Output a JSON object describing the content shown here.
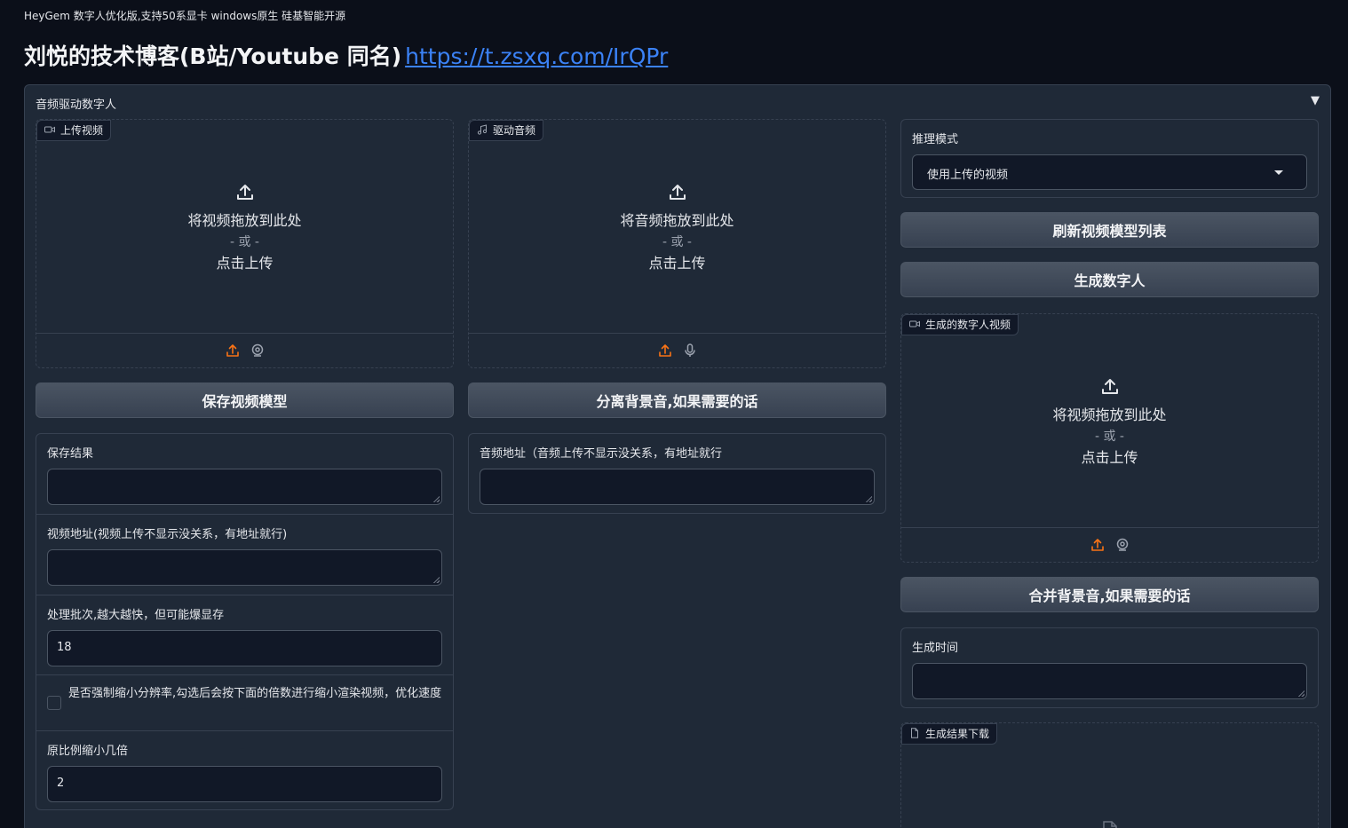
{
  "page": {
    "top_note": "HeyGem 数字人优化版,支持50系显卡 windows原生 硅基智能开源",
    "headline_text": "刘悦的技术博客(B站/Youtube 同名)",
    "headline_link": "https://t.zsxq.com/IrQPr"
  },
  "panel": {
    "title": "音频驱动数字人",
    "toggle": "▼"
  },
  "video_upload": {
    "tag": "上传视频",
    "drop_text": "将视频拖放到此处",
    "or_text": "- 或 -",
    "click_text": "点击上传"
  },
  "audio_upload": {
    "tag": "驱动音频",
    "drop_text": "将音频拖放到此处",
    "or_text": "- 或 -",
    "click_text": "点击上传"
  },
  "buttons": {
    "save_model": "保存视频模型",
    "separate_bg": "分离背景音,如果需要的话",
    "refresh_models": "刷新视频模型列表",
    "generate": "生成数字人",
    "merge_bg": "合并背景音,如果需要的话"
  },
  "left_form": {
    "save_result_label": "保存结果",
    "save_result_value": "",
    "video_path_label": "视频地址(视频上传不显示没关系，有地址就行)",
    "video_path_value": "",
    "batch_label": "处理批次,越大越快，但可能爆显存",
    "batch_value": "18",
    "force_downscale_label": "是否强制缩小分辨率,勾选后会按下面的倍数进行缩小渲染视频，优化速度",
    "force_downscale_checked": false,
    "scale_label": "原比例缩小几倍",
    "scale_value": "2"
  },
  "mid_form": {
    "audio_path_label": "音频地址（音频上传不显示没关系，有地址就行",
    "audio_path_value": ""
  },
  "right": {
    "mode_label": "推理模式",
    "mode_selected": "使用上传的视频",
    "output_video_tag": "生成的数字人视频",
    "output_drop_text": "将视频拖放到此处",
    "output_or_text": "- 或 -",
    "output_click_text": "点击上传",
    "gen_time_label": "生成时间",
    "gen_time_value": "",
    "download_tag": "生成结果下载"
  },
  "colors": {
    "accent_upload_icon": "#f97316",
    "link": "#3b82f6",
    "background": "#0b0f19",
    "panel": "#1f2937"
  }
}
